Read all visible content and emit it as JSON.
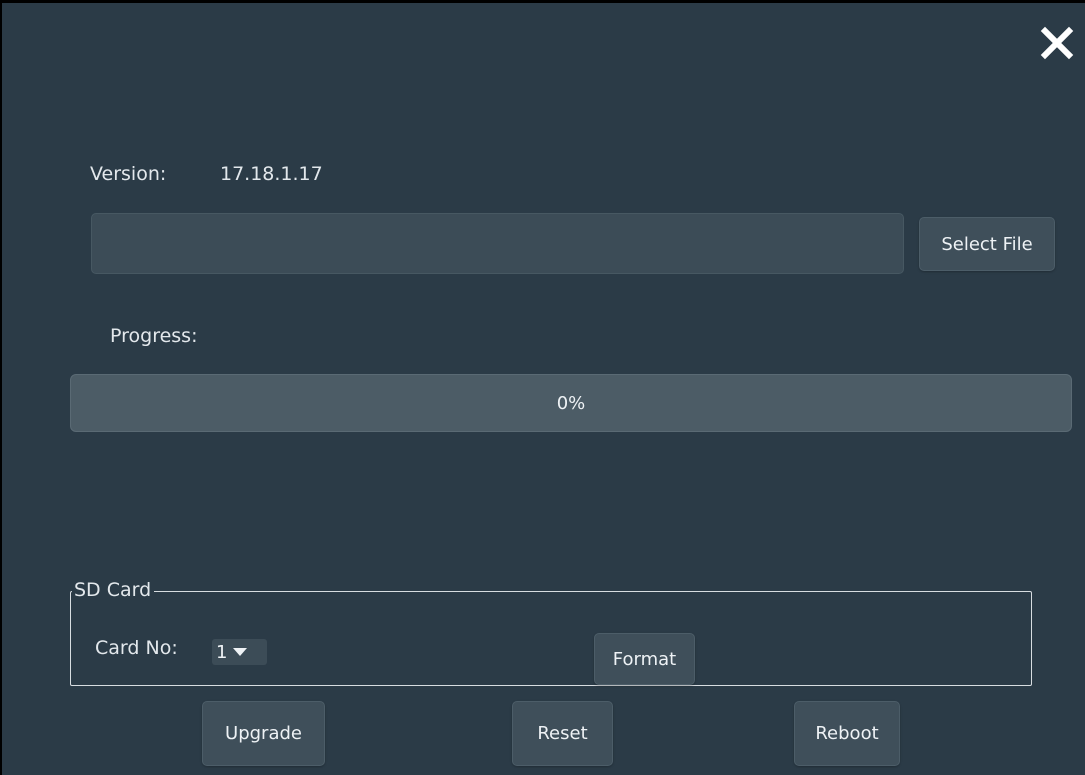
{
  "dialog": {
    "close_icon": "close-icon"
  },
  "version": {
    "label": "Version:",
    "value": "17.18.1.17"
  },
  "file": {
    "path_value": "",
    "select_button_label": "Select File"
  },
  "progress": {
    "label": "Progress:",
    "percent": 0,
    "text": "0%"
  },
  "sd_card": {
    "group_title": "SD Card",
    "card_no_label": "Card No:",
    "card_no_selected": "1",
    "format_button_label": "Format"
  },
  "actions": {
    "upgrade_label": "Upgrade",
    "reset_label": "Reset",
    "reboot_label": "Reboot"
  },
  "colors": {
    "background": "#2b3b47",
    "control": "#3f4f5a",
    "progress_track": "#4c5c66",
    "text": "#e3e8ec"
  }
}
